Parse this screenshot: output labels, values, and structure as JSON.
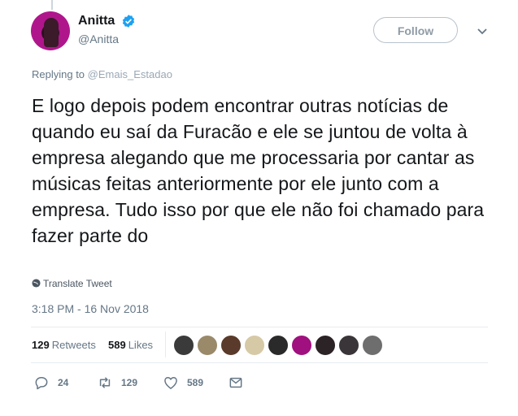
{
  "header": {
    "display_name": "Anitta",
    "handle": "@Anitta",
    "follow_label": "Follow"
  },
  "reply": {
    "prefix": "Replying to",
    "handle": "@Emais_Estadao"
  },
  "tweet": {
    "text": "E logo depois podem encontrar outras notícias de quando eu saí da Furacão e ele se juntou de volta à empresa alegando que me processaria por cantar as músicas feitas anteriormente por ele junto com a empresa. Tudo isso por que ele não foi chamado para fazer parte do",
    "translate_label": "Translate Tweet",
    "timestamp": "3:18 PM - 16 Nov 2018"
  },
  "stats": {
    "retweets_count": "129",
    "retweets_label": "Retweets",
    "likes_count": "589",
    "likes_label": "Likes"
  },
  "actions": {
    "reply_count": "24",
    "retweet_count": "129",
    "like_count": "589"
  },
  "colors": {
    "verified": "#1da1f2",
    "avatar": "#b0168c",
    "muted": "#657786"
  },
  "icons": [
    "verified-icon",
    "chevron-down-icon",
    "globe-icon",
    "reply-icon",
    "retweet-icon",
    "heart-icon",
    "message-icon"
  ]
}
